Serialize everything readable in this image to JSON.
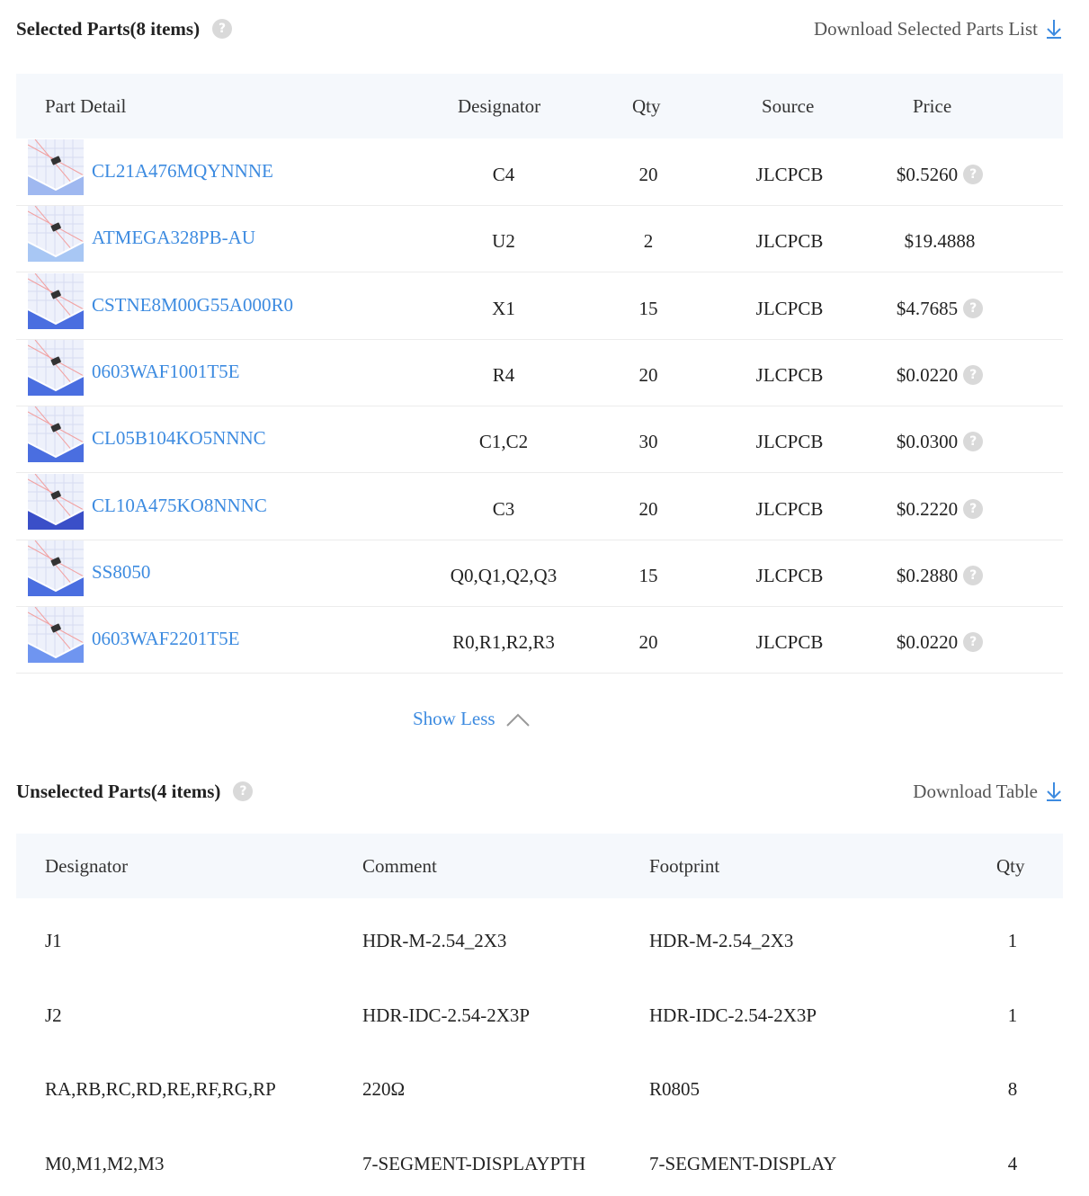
{
  "selected": {
    "title": "Selected Parts(8 items)",
    "help": "?",
    "download_label": "Download Selected Parts List",
    "columns": [
      "Part Detail",
      "Designator",
      "Qty",
      "Source",
      "Price"
    ],
    "rows": [
      {
        "part": "CL21A476MQYNNNE",
        "designator": "C4",
        "qty": "20",
        "source": "JLCPCB",
        "price": "$0.5260",
        "price_help": "?"
      },
      {
        "part": "ATMEGA328PB-AU",
        "designator": "U2",
        "qty": "2",
        "source": "JLCPCB",
        "price": "$19.4888",
        "price_help": ""
      },
      {
        "part": "CSTNE8M00G55A000R0",
        "designator": "X1",
        "qty": "15",
        "source": "JLCPCB",
        "price": "$4.7685",
        "price_help": "?"
      },
      {
        "part": "0603WAF1001T5E",
        "designator": "R4",
        "qty": "20",
        "source": "JLCPCB",
        "price": "$0.0220",
        "price_help": "?"
      },
      {
        "part": "CL05B104KO5NNNC",
        "designator": "C1,C2",
        "qty": "30",
        "source": "JLCPCB",
        "price": "$0.0300",
        "price_help": "?"
      },
      {
        "part": "CL10A475KO8NNNC",
        "designator": "C3",
        "qty": "20",
        "source": "JLCPCB",
        "price": "$0.2220",
        "price_help": "?"
      },
      {
        "part": "SS8050",
        "designator": "Q0,Q1,Q2,Q3",
        "qty": "15",
        "source": "JLCPCB",
        "price": "$0.2880",
        "price_help": "?"
      },
      {
        "part": "0603WAF2201T5E",
        "designator": "R0,R1,R2,R3",
        "qty": "20",
        "source": "JLCPCB",
        "price": "$0.0220",
        "price_help": "?"
      }
    ],
    "show_less_label": "Show Less"
  },
  "unselected": {
    "title": "Unselected Parts(4 items)",
    "help": "?",
    "download_label": "Download Table",
    "columns": [
      "Designator",
      "Comment",
      "Footprint",
      "Qty"
    ],
    "rows": [
      {
        "designator": "J1",
        "comment": "HDR-M-2.54_2X3",
        "footprint": "HDR-M-2.54_2X3",
        "qty": "1"
      },
      {
        "designator": "J2",
        "comment": "HDR-IDC-2.54-2X3P",
        "footprint": "HDR-IDC-2.54-2X3P",
        "qty": "1"
      },
      {
        "designator": "RA,RB,RC,RD,RE,RF,RG,RP",
        "comment": "220Ω",
        "footprint": "R0805",
        "qty": "8"
      },
      {
        "designator": "M0,M1,M2,M3",
        "comment": "7-SEGMENT-DISPLAYPTH",
        "footprint": "7-SEGMENT-DISPLAY",
        "qty": "4"
      }
    ]
  },
  "colors": {
    "link": "#3d8be0",
    "header_bg": "#f5f8fc",
    "help": "#d9d9d9"
  }
}
